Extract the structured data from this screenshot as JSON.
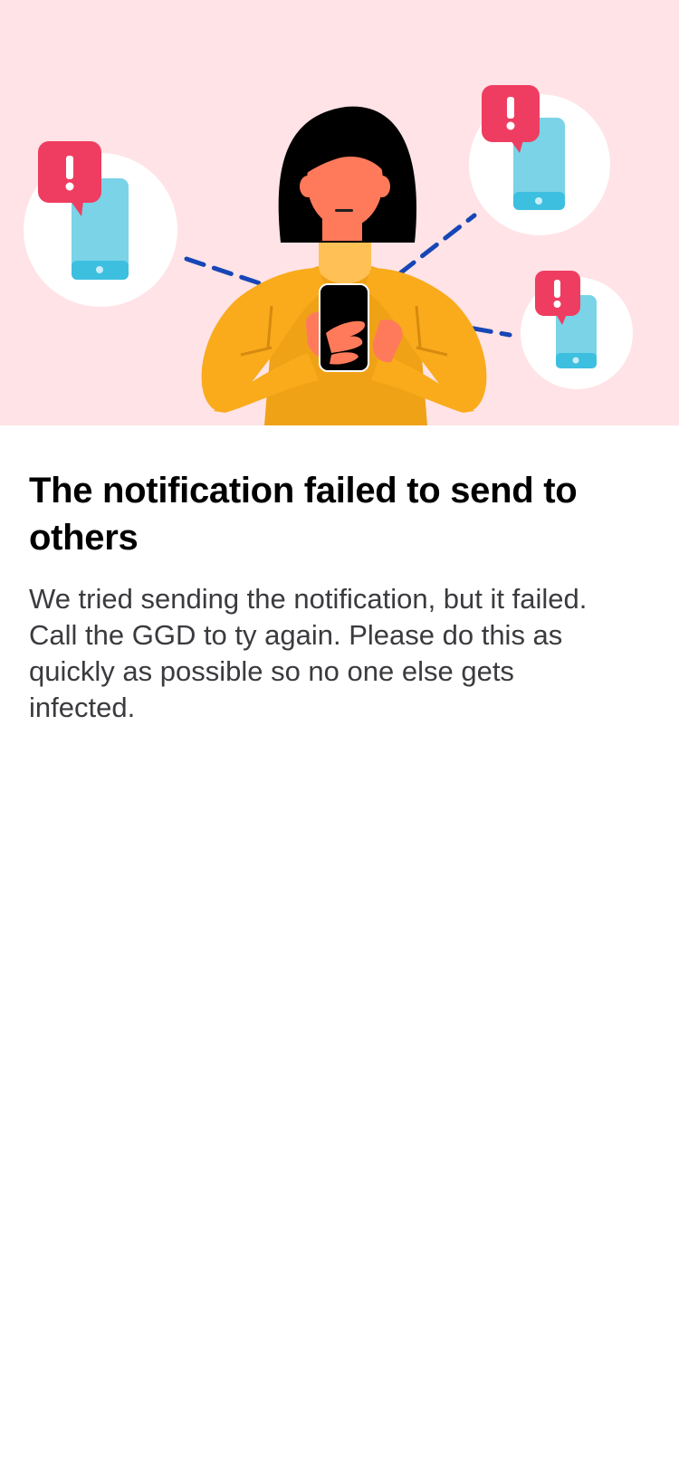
{
  "hero": {
    "illustration": "person-phone-failed-notifications",
    "colors": {
      "background": "#ffe3e6",
      "alert": "#ef3d61",
      "phone": "#7ad3e6",
      "sweater": "#f9ab1c",
      "skin": "#ff7a5a",
      "dashes": "#1746b6"
    }
  },
  "content": {
    "title": "The notification failed to send to others",
    "body": "We tried sending the notification, but it failed. Call the GGD to ty again. Please do this as quickly as possible so no one else gets infected."
  }
}
